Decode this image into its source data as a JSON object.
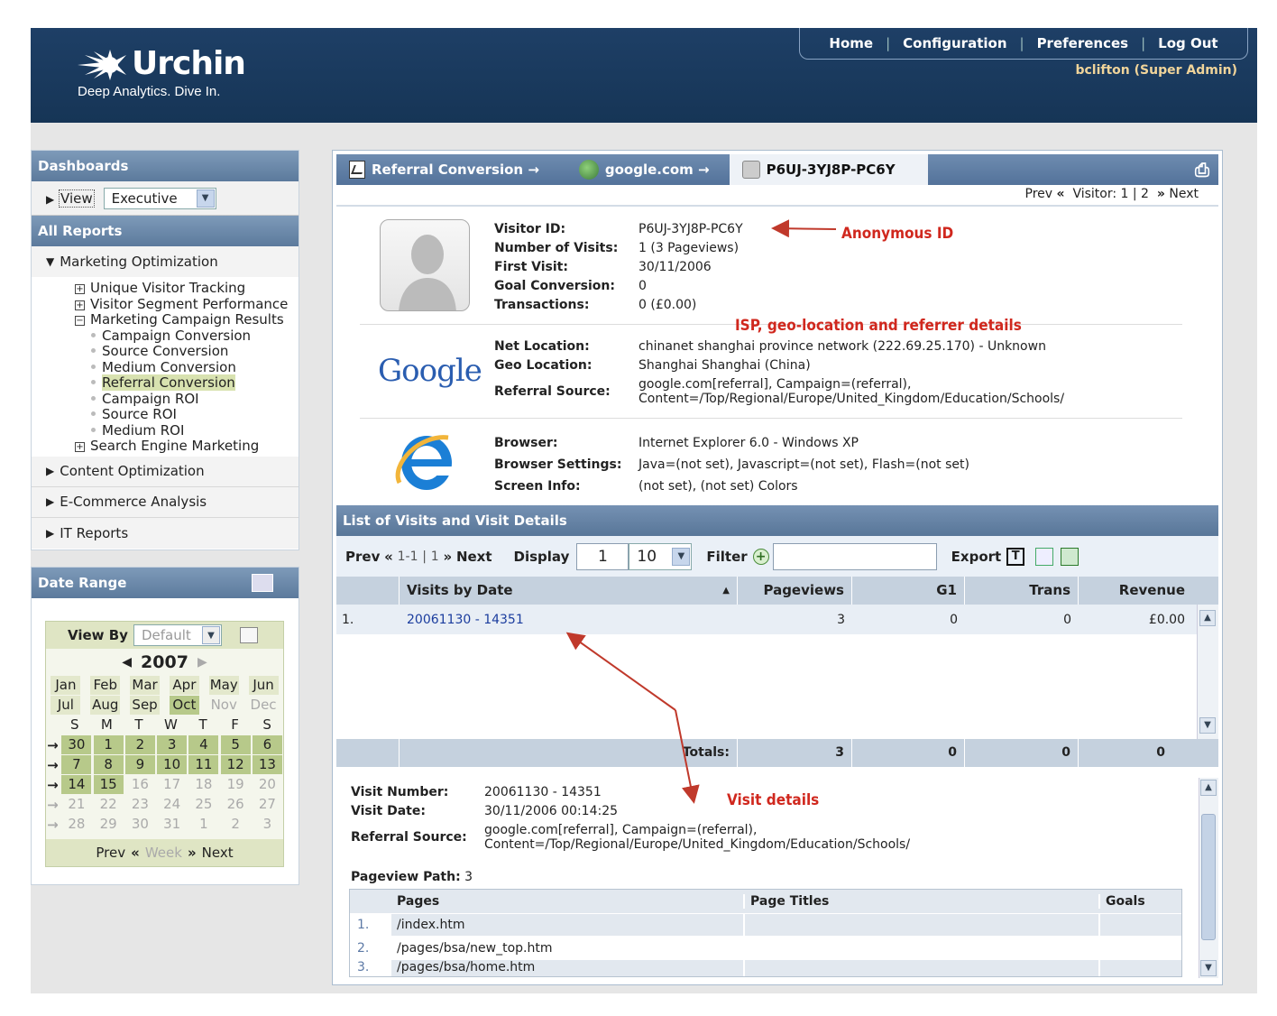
{
  "brand": {
    "name": "Urchin",
    "tagline": "Deep Analytics. Dive In."
  },
  "topnav": {
    "home": "Home",
    "configuration": "Configuration",
    "preferences": "Preferences",
    "logout": "Log Out",
    "sep": "|"
  },
  "user": "bclifton (Super Admin)",
  "left": {
    "dashboards_title": "Dashboards",
    "view_label": "View",
    "view_value": "Executive",
    "all_reports_title": "All Reports",
    "marketing": "Marketing Optimization",
    "tree": {
      "uvt": "Unique Visitor Tracking",
      "vsp": "Visitor Segment Performance",
      "mcr": "Marketing Campaign Results",
      "items": [
        "Campaign Conversion",
        "Source Conversion",
        "Medium Conversion",
        "Referral Conversion",
        "Campaign ROI",
        "Source ROI",
        "Medium ROI"
      ],
      "sem": "Search Engine Marketing"
    },
    "content_opt": "Content Optimization",
    "ecommerce": "E-Commerce Analysis",
    "it": "IT Reports",
    "date_range_title": "Date Range",
    "view_by": "View By",
    "view_by_value": "Default",
    "year": "2007",
    "months1": [
      "Jan",
      "Feb",
      "Mar",
      "Apr",
      "May",
      "Jun"
    ],
    "months2": [
      "Jul",
      "Aug",
      "Sep",
      "Oct",
      "Nov",
      "Dec"
    ],
    "weekdays": [
      "S",
      "M",
      "T",
      "W",
      "T",
      "F",
      "S"
    ],
    "weeks": [
      [
        "30",
        "1",
        "2",
        "3",
        "4",
        "5",
        "6"
      ],
      [
        "7",
        "8",
        "9",
        "10",
        "11",
        "12",
        "13"
      ],
      [
        "14",
        "15",
        "16",
        "17",
        "18",
        "19",
        "20"
      ],
      [
        "21",
        "22",
        "23",
        "24",
        "25",
        "26",
        "27"
      ],
      [
        "28",
        "29",
        "30",
        "31",
        "1",
        "2",
        "3"
      ]
    ],
    "cal_prev": "Prev",
    "cal_week": "Week",
    "cal_next": "Next"
  },
  "tabs": {
    "t1": "Referral Conversion →",
    "t2": "google.com →",
    "t3": "P6UJ-3YJ8P-PC6Y"
  },
  "pager": {
    "prev": "Prev",
    "visitor": "Visitor: 1 | 2",
    "next": "Next"
  },
  "visitor": {
    "id_k": "Visitor ID:",
    "id_v": "P6UJ-3YJ8P-PC6Y",
    "visits_k": "Number of Visits:",
    "visits_v": "1 (3 Pageviews)",
    "first_k": "First Visit:",
    "first_v": "30/11/2006",
    "goal_k": "Goal Conversion:",
    "goal_v": "0",
    "trans_k": "Transactions:",
    "trans_v": "0 (£0.00)",
    "net_k": "Net Location:",
    "net_v": "chinanet shanghai province network (222.69.25.170) - Unknown",
    "geo_k": "Geo Location:",
    "geo_v": "Shanghai Shanghai (China)",
    "ref_k": "Referral Source:",
    "ref_v1": "google.com[referral], Campaign=(referral),",
    "ref_v2": "Content=/Top/Regional/Europe/United_Kingdom/Education/Schools/",
    "browser_k": "Browser:",
    "browser_v": "Internet Explorer 6.0 - Windows XP",
    "bset_k": "Browser Settings:",
    "bset_v": "Java=(not set), Javascript=(not set), Flash=(not set)",
    "screen_k": "Screen Info:",
    "screen_v": "(not set), (not set) Colors",
    "google_logo": "Google"
  },
  "notes": {
    "anon": "Anonymous ID",
    "isp": "ISP, geo-location and referrer details",
    "visit": "Visit details"
  },
  "list": {
    "title": "List of Visits and Visit Details",
    "prev": "Prev",
    "range": "1-1",
    "sep": "|",
    "page": "1",
    "next": "Next",
    "display": "Display",
    "display_start": "1",
    "display_count": "10",
    "filter": "Filter",
    "export": "Export",
    "cols": [
      "Visits by Date",
      "Pageviews",
      "G1",
      "Trans",
      "Revenue"
    ],
    "row": {
      "n": "1.",
      "date": "20061130 - 14351",
      "pv": "3",
      "g1": "0",
      "trans": "0",
      "rev": "£0.00"
    },
    "totals": {
      "label": "Totals:",
      "pv": "3",
      "g1": "0",
      "trans": "0",
      "rev": "0"
    }
  },
  "visit": {
    "num_k": "Visit Number:",
    "num_v": "20061130 - 14351",
    "date_k": "Visit Date:",
    "date_v": "30/11/2006 00:14:25",
    "ref_k": "Referral Source:",
    "ref_v1": "google.com[referral], Campaign=(referral),",
    "ref_v2": "Content=/Top/Regional/Europe/United_Kingdom/Education/Schools/",
    "path_k": "Pageview Path:",
    "path_v": "3",
    "pcols": [
      "Pages",
      "Page Titles",
      "Goals"
    ],
    "pages": [
      {
        "n": "1.",
        "page": "/index.htm"
      },
      {
        "n": "2.",
        "page": "/pages/bsa/new_top.htm"
      },
      {
        "n": "3.",
        "page": "/pages/bsa/home.htm"
      }
    ]
  }
}
